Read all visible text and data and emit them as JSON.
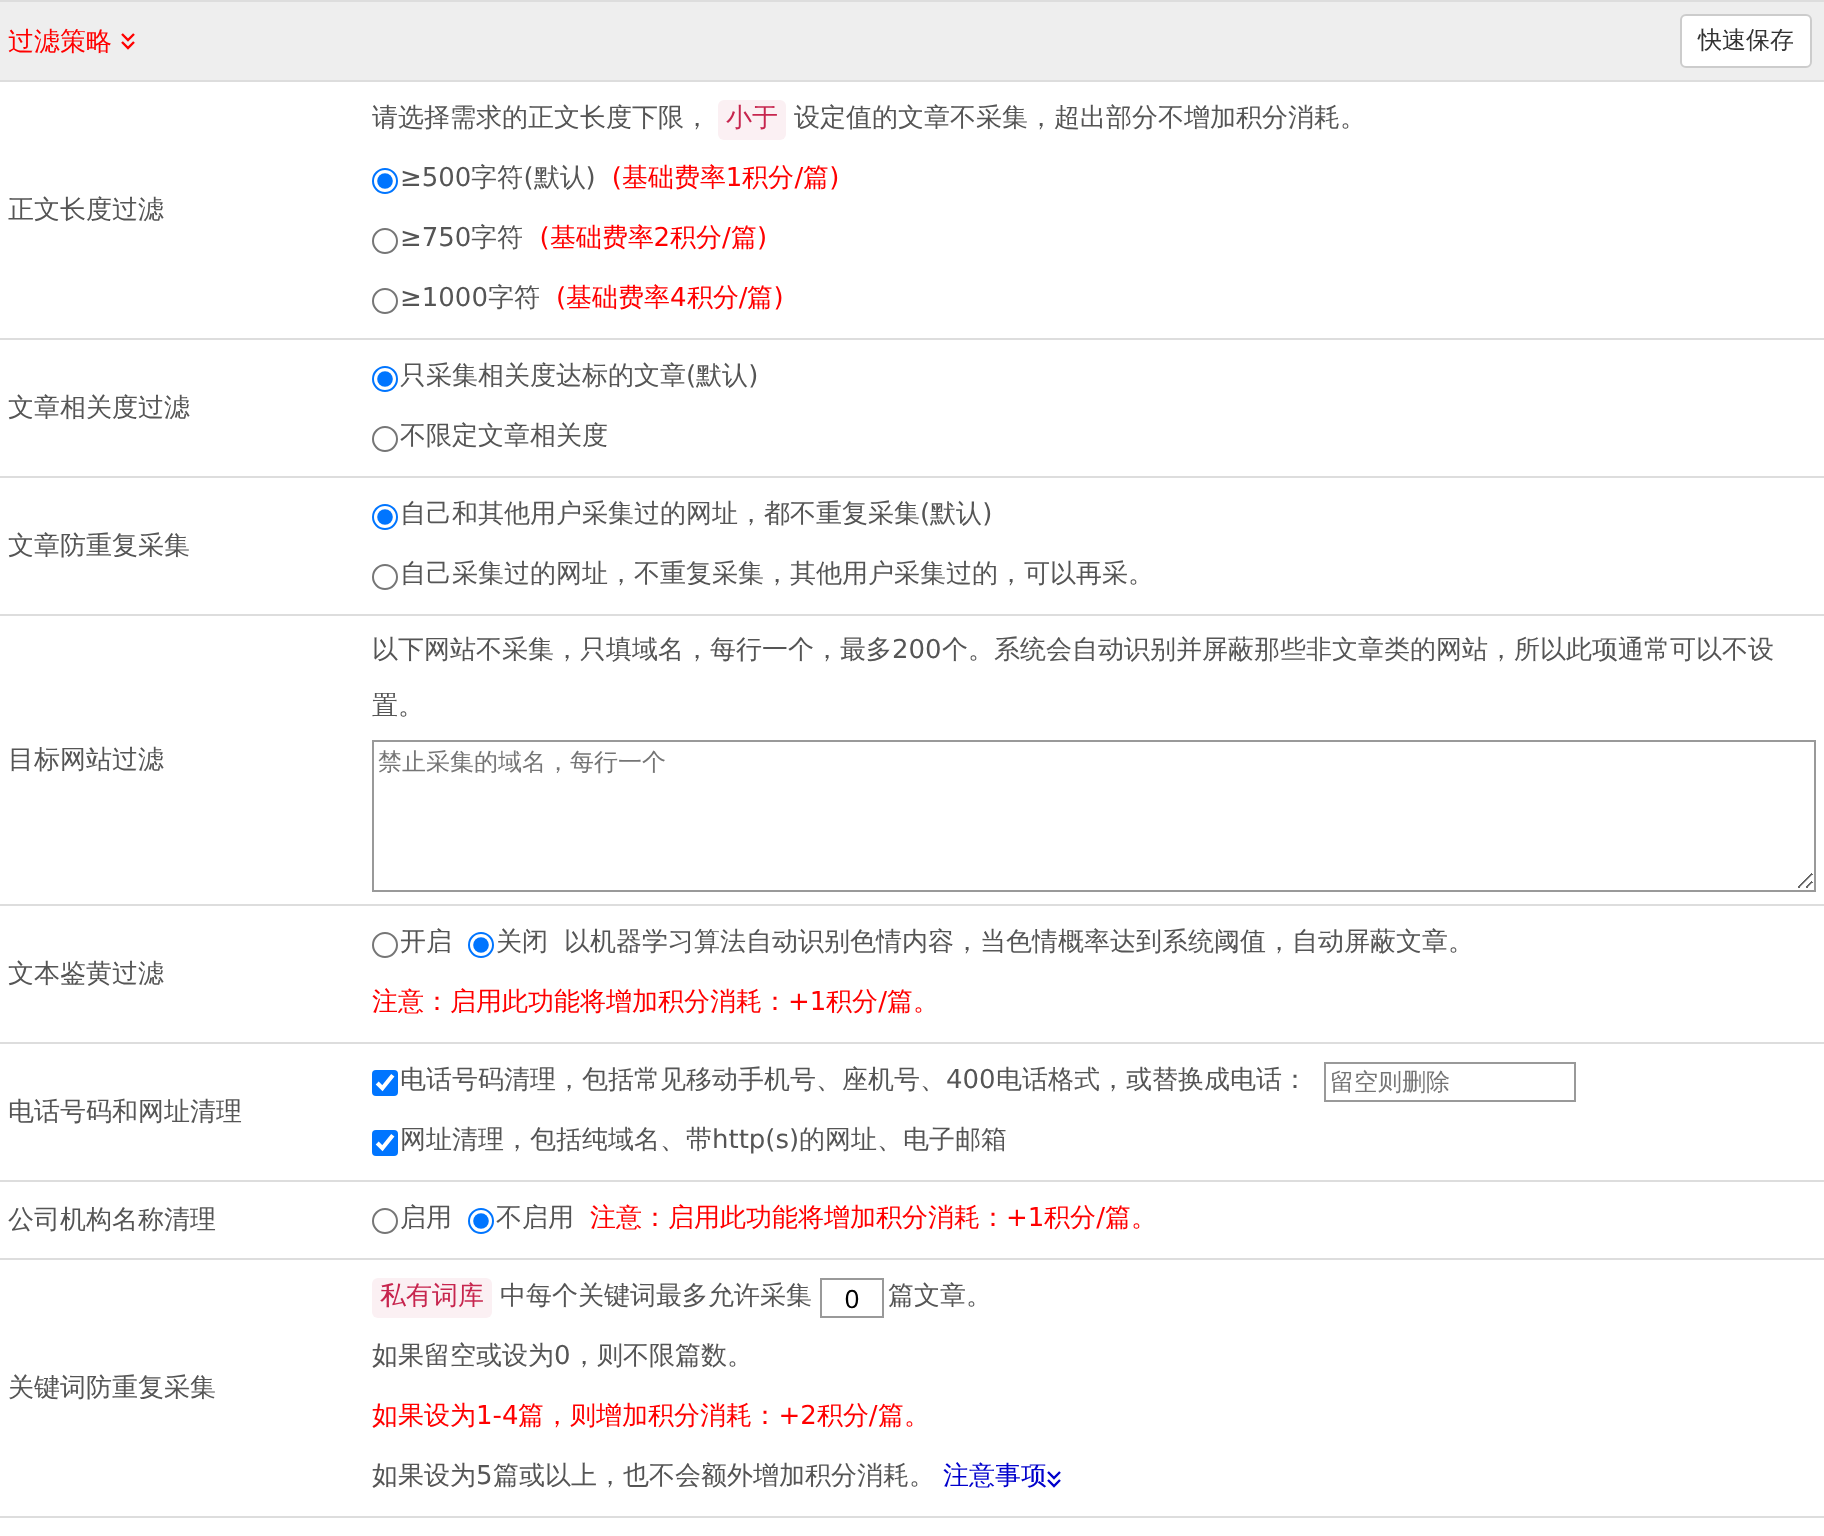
{
  "header": {
    "title": "过滤策略",
    "save_button": "快速保存"
  },
  "sections": [
    {
      "label": "正文长度过滤",
      "lines": [
        {
          "parts": [
            {
              "kind": "text",
              "text": "请选择需求的正文长度下限，"
            },
            {
              "kind": "tag",
              "text": "小于"
            },
            {
              "kind": "text",
              "text": "设定值的文章不采集，超出部分不增加积分消耗。"
            }
          ]
        },
        {
          "parts": [
            {
              "kind": "radio",
              "label": "≥500字符(默认)",
              "selected": true
            },
            {
              "kind": "warning",
              "text": "(基础费率1积分/篇)"
            }
          ]
        },
        {
          "parts": [
            {
              "kind": "radio",
              "label": "≥750字符",
              "selected": false
            },
            {
              "kind": "warning",
              "text": "(基础费率2积分/篇)"
            }
          ]
        },
        {
          "parts": [
            {
              "kind": "radio",
              "label": "≥1000字符",
              "selected": false
            },
            {
              "kind": "warning",
              "text": "(基础费率4积分/篇)"
            }
          ]
        }
      ]
    },
    {
      "label": "文章相关度过滤",
      "lines": [
        {
          "parts": [
            {
              "kind": "radio",
              "label": "只采集相关度达标的文章(默认)",
              "selected": true
            }
          ]
        },
        {
          "parts": [
            {
              "kind": "radio",
              "label": "不限定文章相关度",
              "selected": false
            }
          ]
        }
      ]
    },
    {
      "label": "文章防重复采集",
      "lines": [
        {
          "parts": [
            {
              "kind": "radio",
              "label": "自己和其他用户采集过的网址，都不重复采集(默认)",
              "selected": true
            }
          ]
        },
        {
          "parts": [
            {
              "kind": "radio",
              "label": "自己采集过的网址，不重复采集，其他用户采集过的，可以再采。",
              "selected": false
            }
          ]
        }
      ]
    },
    {
      "label": "目标网站过滤",
      "lines": [
        {
          "parts": [
            {
              "kind": "text",
              "text": "以下网站不采集，只填域名，每行一个，最多200个。系统会自动识别并屏蔽那些非文章类的网站，所以此项通常可以不设置。"
            }
          ]
        },
        {
          "parts": [
            {
              "kind": "textarea",
              "placeholder": "禁止采集的域名，每行一个"
            }
          ]
        }
      ]
    },
    {
      "label": "文本鉴黄过滤",
      "lines": [
        {
          "parts": [
            {
              "kind": "radio",
              "label": "开启",
              "selected": false
            },
            {
              "kind": "radio",
              "label": "关闭",
              "selected": true
            },
            {
              "kind": "text",
              "text": "以机器学习算法自动识别色情内容，当色情概率达到系统阈值，自动屏蔽文章。"
            }
          ]
        },
        {
          "parts": [
            {
              "kind": "warning",
              "text": "注意：启用此功能将增加积分消耗：+1积分/篇。"
            }
          ]
        }
      ]
    },
    {
      "label": "电话号码和网址清理",
      "lines": [
        {
          "parts": [
            {
              "kind": "checkbox",
              "label": "电话号码清理，包括常见移动手机号、座机号、400电话格式，或替换成电话：",
              "checked": true
            },
            {
              "kind": "input",
              "placeholder": "留空则删除"
            }
          ]
        },
        {
          "parts": [
            {
              "kind": "checkbox",
              "label": "网址清理，包括纯域名、带http(s)的网址、电子邮箱",
              "checked": true
            }
          ]
        }
      ]
    },
    {
      "label": "公司机构名称清理",
      "lines": [
        {
          "parts": [
            {
              "kind": "radio",
              "label": "启用",
              "selected": false
            },
            {
              "kind": "radio",
              "label": "不启用",
              "selected": true
            },
            {
              "kind": "warning",
              "text": "注意：启用此功能将增加积分消耗：+1积分/篇。"
            }
          ]
        }
      ]
    },
    {
      "label": "关键词防重复采集",
      "lines": [
        {
          "parts": [
            {
              "kind": "tag",
              "text": "私有词库"
            },
            {
              "kind": "text",
              "text": "中每个关键词最多允许采集"
            },
            {
              "kind": "number",
              "value": "0"
            },
            {
              "kind": "text",
              "text": "篇文章。"
            }
          ]
        },
        {
          "parts": [
            {
              "kind": "text",
              "text": "如果留空或设为0，则不限篇数。"
            }
          ]
        },
        {
          "parts": [
            {
              "kind": "warning",
              "text": "如果设为1-4篇，则增加积分消耗：+2积分/篇。"
            }
          ]
        },
        {
          "parts": [
            {
              "kind": "text",
              "text": "如果设为5篇或以上，也不会额外增加积分消耗。"
            },
            {
              "kind": "link",
              "text": "注意事项"
            }
          ]
        }
      ]
    }
  ]
}
